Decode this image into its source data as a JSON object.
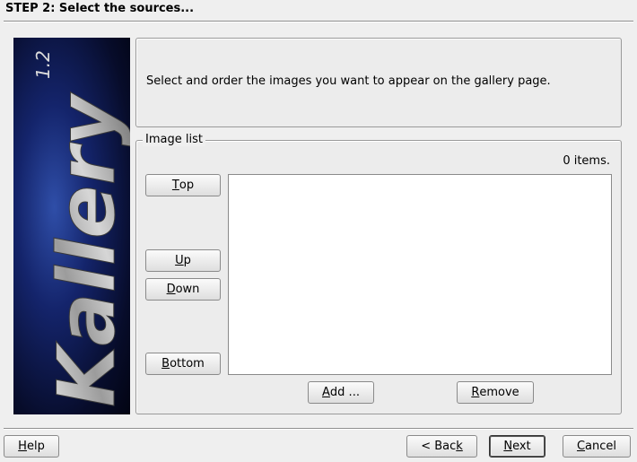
{
  "header": {
    "title": "STEP 2: Select the sources..."
  },
  "banner": {
    "logo_text": "Kallery",
    "version": "1.2"
  },
  "intro": {
    "text": "Select and order the images you want to appear on the gallery page."
  },
  "image_list": {
    "legend": "Image list",
    "count": "0 items.",
    "buttons": {
      "top": {
        "mnemonic": "T",
        "rest": "op"
      },
      "up": {
        "mnemonic": "U",
        "rest": "p"
      },
      "down": {
        "mnemonic": "D",
        "rest": "own"
      },
      "bottom": {
        "mnemonic": "B",
        "rest": "ottom"
      },
      "add": {
        "mnemonic": "A",
        "rest": "dd ..."
      },
      "remove": {
        "mnemonic": "R",
        "rest": "emove"
      }
    },
    "items": []
  },
  "footer": {
    "help": {
      "mnemonic": "H",
      "rest": "elp"
    },
    "back": {
      "prefix": "< ",
      "pre": "Bac",
      "mnemonic": "k",
      "rest": ""
    },
    "next": {
      "mnemonic": "N",
      "rest": "ext"
    },
    "cancel": {
      "mnemonic": "C",
      "rest": "ancel"
    }
  }
}
